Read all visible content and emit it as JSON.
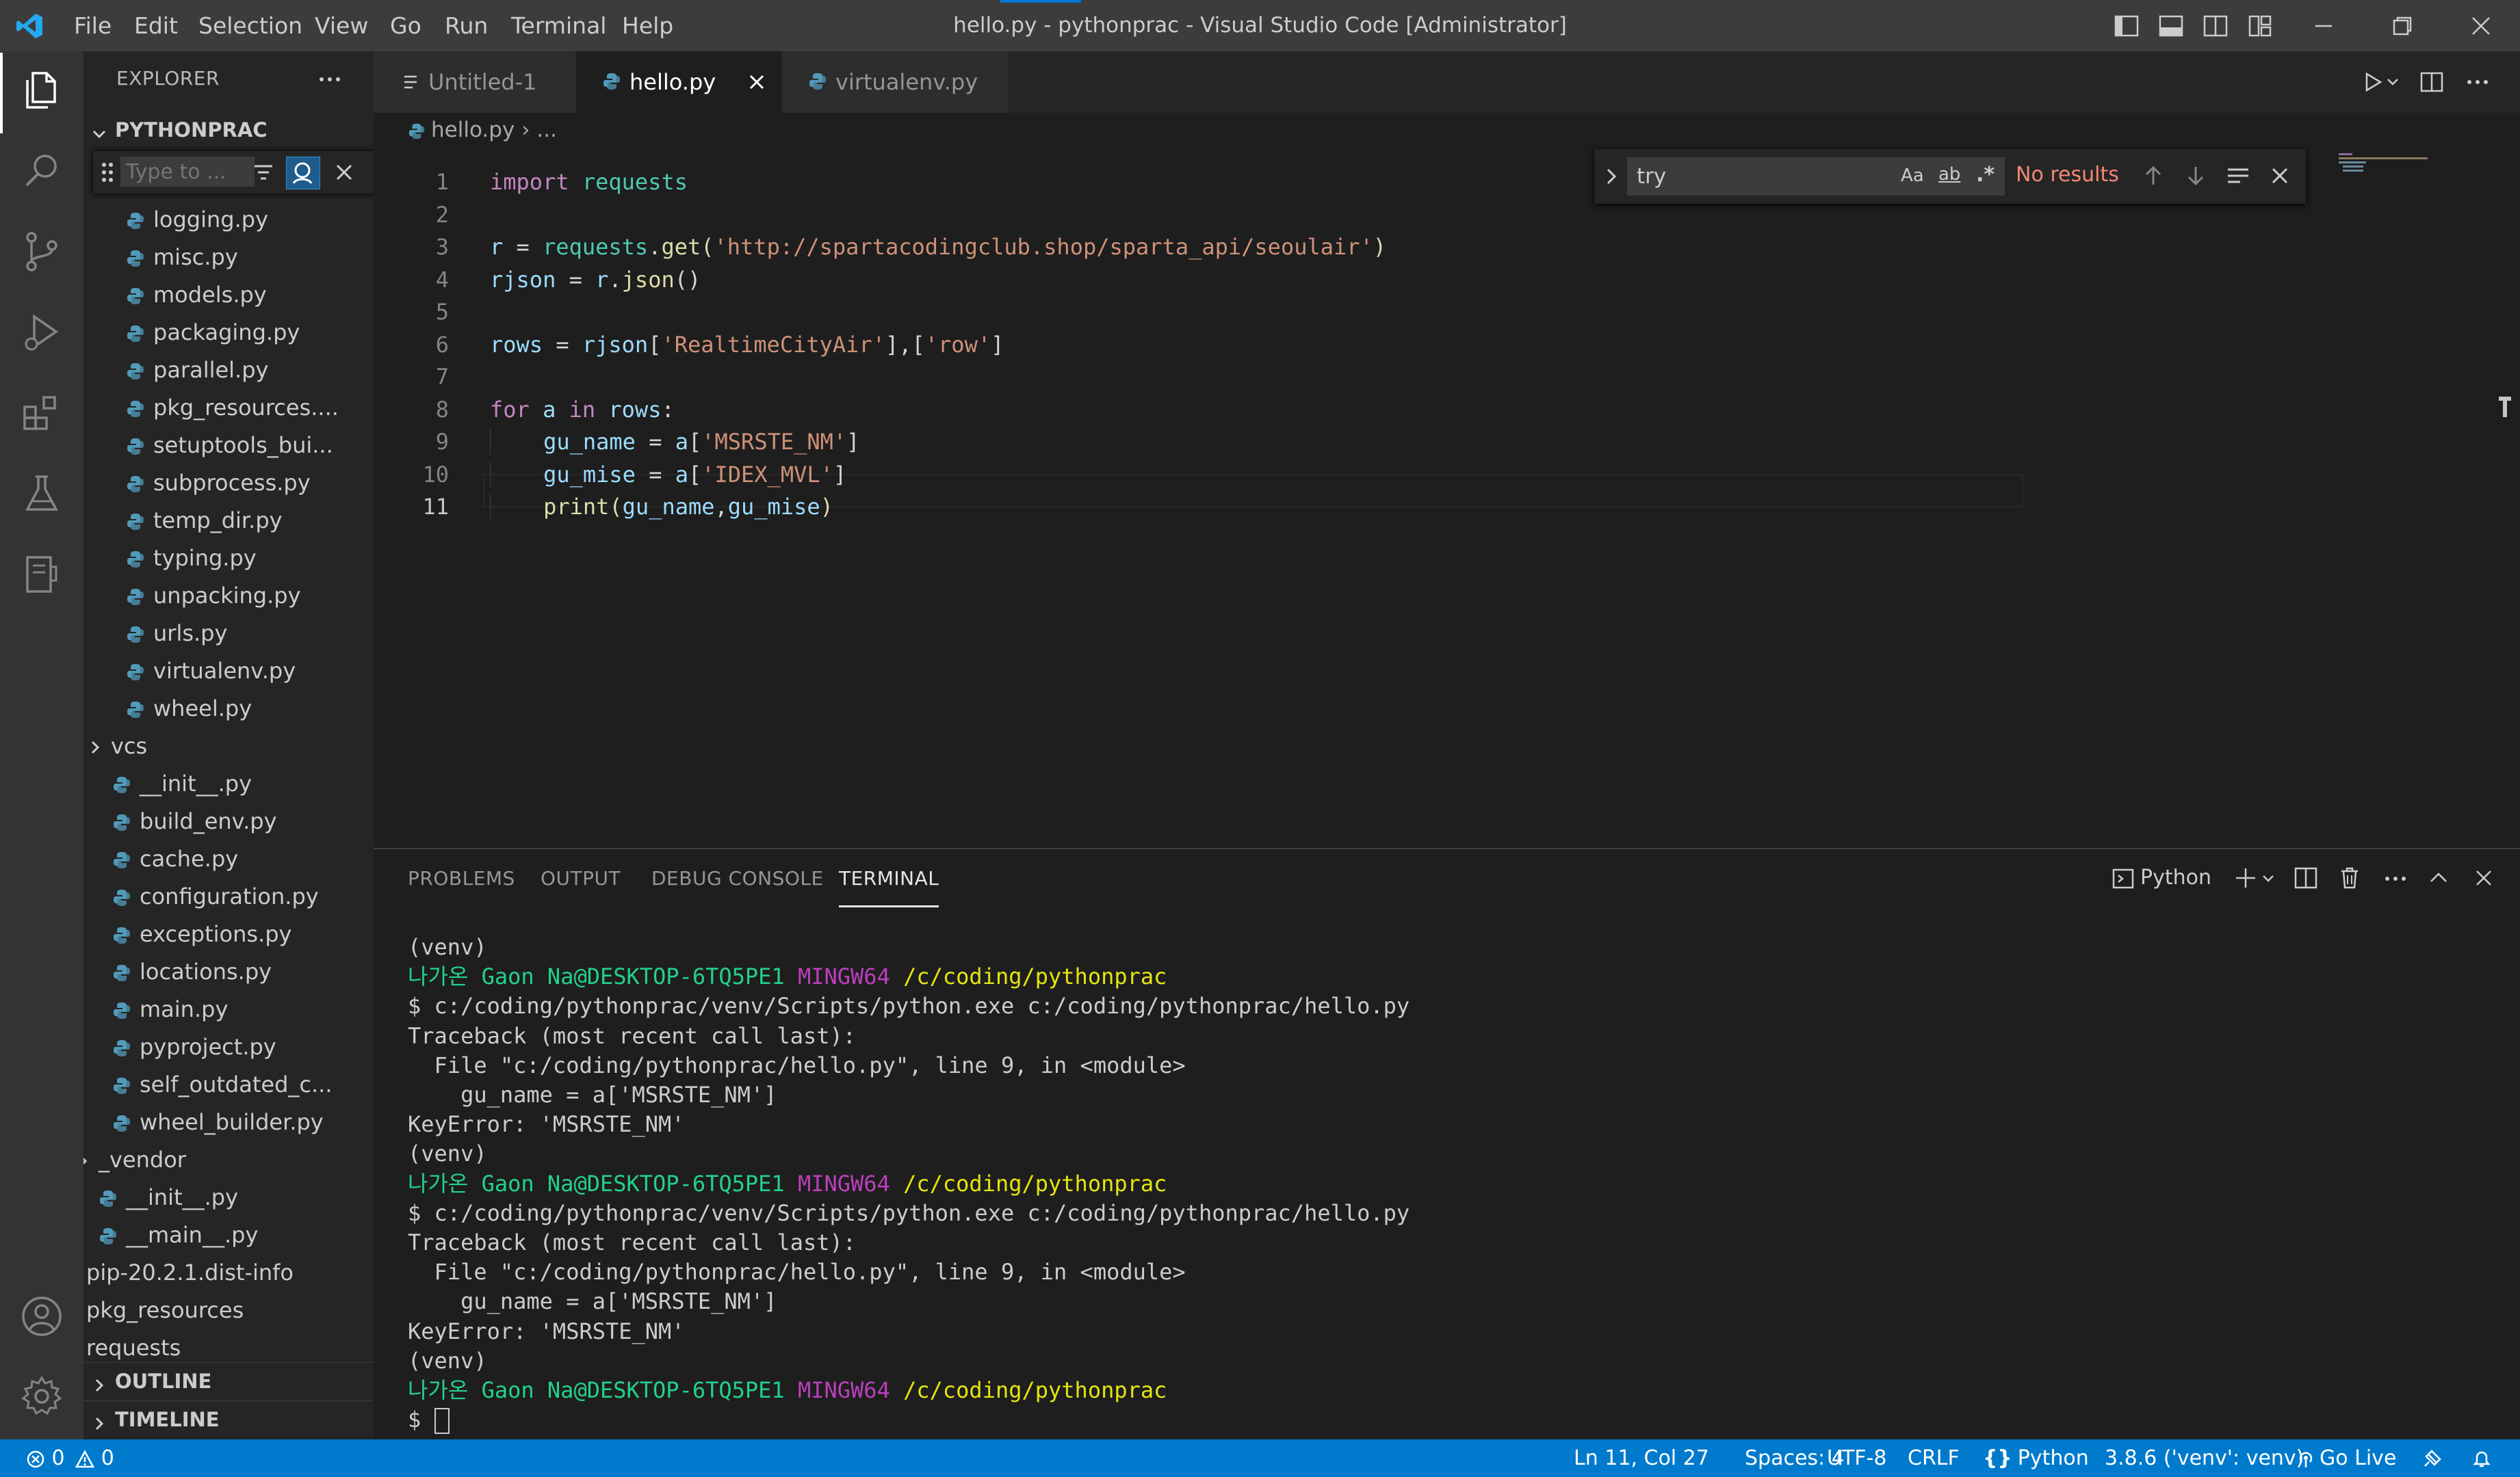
{
  "titlebar": {
    "menus": [
      "File",
      "Edit",
      "Selection",
      "View",
      "Go",
      "Run",
      "Terminal",
      "Help"
    ],
    "title": "hello.py - pythonprac - Visual Studio Code [Administrator]"
  },
  "sidebar": {
    "header": "EXPLORER",
    "folder": "PYTHONPRAC",
    "filter_placeholder": "Type to ...",
    "items": [
      {
        "label": "logging.py",
        "type": "file"
      },
      {
        "label": "misc.py",
        "type": "file"
      },
      {
        "label": "models.py",
        "type": "file"
      },
      {
        "label": "packaging.py",
        "type": "file"
      },
      {
        "label": "parallel.py",
        "type": "file"
      },
      {
        "label": "pkg_resources....",
        "type": "file"
      },
      {
        "label": "setuptools_bui...",
        "type": "file"
      },
      {
        "label": "subprocess.py",
        "type": "file"
      },
      {
        "label": "temp_dir.py",
        "type": "file"
      },
      {
        "label": "typing.py",
        "type": "file"
      },
      {
        "label": "unpacking.py",
        "type": "file"
      },
      {
        "label": "urls.py",
        "type": "file"
      },
      {
        "label": "virtualenv.py",
        "type": "file"
      },
      {
        "label": "wheel.py",
        "type": "file"
      },
      {
        "label": "vcs",
        "type": "folder"
      },
      {
        "label": "__init__.py",
        "type": "file"
      },
      {
        "label": "build_env.py",
        "type": "file"
      },
      {
        "label": "cache.py",
        "type": "file"
      },
      {
        "label": "configuration.py",
        "type": "file"
      },
      {
        "label": "exceptions.py",
        "type": "file"
      },
      {
        "label": "locations.py",
        "type": "file"
      },
      {
        "label": "main.py",
        "type": "file"
      },
      {
        "label": "pyproject.py",
        "type": "file"
      },
      {
        "label": "self_outdated_c...",
        "type": "file"
      },
      {
        "label": "wheel_builder.py",
        "type": "file"
      },
      {
        "label": "_vendor",
        "type": "folder"
      },
      {
        "label": "__init__.py",
        "type": "file"
      },
      {
        "label": "__main__.py",
        "type": "file"
      },
      {
        "label": "pip-20.2.1.dist-info",
        "type": "folder"
      },
      {
        "label": "pkg_resources",
        "type": "folder"
      },
      {
        "label": "requests",
        "type": "folder"
      }
    ],
    "outline": "OUTLINE",
    "timeline": "TIMELINE"
  },
  "tabs": [
    {
      "label": "Untitled-1"
    },
    {
      "label": "hello.py"
    },
    {
      "label": "virtualenv.py"
    }
  ],
  "breadcrumb": {
    "file": "hello.py",
    "rest": "..."
  },
  "find": {
    "query": "try",
    "results": "No results",
    "case": "Aa",
    "word": "ab",
    "regex": ".*"
  },
  "editor": {
    "line_numbers": [
      "1",
      "2",
      "3",
      "4",
      "5",
      "6",
      "7",
      "8",
      "9",
      "10",
      "11"
    ],
    "lines": {
      "l1": {
        "kw": "import",
        "mod": "requests"
      },
      "l3": {
        "var": "r",
        "eq": " = ",
        "mod": "requests",
        "dot": ".",
        "fn": "get",
        "open": "(",
        "str": "'http://spartacodingclub.shop/sparta_api/seoulair'",
        "close": ")"
      },
      "l4": {
        "var": "rjson",
        "eq": " = ",
        "obj": "r",
        "dot": ".",
        "fn": "json",
        "paren": "()"
      },
      "l6": {
        "var": "rows",
        "eq": " = ",
        "obj": "rjson",
        "b1": "[",
        "s1": "'RealtimeCityAir'",
        "b2": "],[",
        "s2": "'row'",
        "b3": "]"
      },
      "l8": {
        "kw": "for",
        "v1": "a",
        "in": "in",
        "v2": "rows",
        "colon": ":"
      },
      "l9": {
        "var": "gu_name",
        "eq": " = ",
        "obj": "a",
        "b1": "[",
        "str": "'MSRSTE_NM'",
        "b2": "]"
      },
      "l10": {
        "var": "gu_mise",
        "eq": " = ",
        "obj": "a",
        "b1": "[",
        "str": "'IDEX_MVL'",
        "b2": "]"
      },
      "l11": {
        "fn": "print",
        "open": "(",
        "a1": "gu_name",
        "comma": ",",
        "a2": "gu_mise",
        "close": ")"
      }
    }
  },
  "panel": {
    "tabs": [
      "PROBLEMS",
      "OUTPUT",
      "DEBUG CONSOLE",
      "TERMINAL"
    ],
    "terminal_name": "Python",
    "terminal": {
      "venv": "(venv)",
      "user": "나가온 Gaon Na@DESKTOP-6TQ5PE1",
      "shell": "MINGW64",
      "path": "/c/coding/pythonprac",
      "cmd": "$ c:/coding/pythonprac/venv/Scripts/python.exe c:/coding/pythonprac/hello.py",
      "tb": "Traceback (most recent call last):",
      "file": "  File \"c:/coding/pythonprac/hello.py\", line 9, in <module>",
      "code": "    gu_name = a['MSRSTE_NM']",
      "err": "KeyError: 'MSRSTE_NM'",
      "prompt": "$ "
    }
  },
  "statusbar": {
    "errors": "0",
    "warnings": "0",
    "position": "Ln 11, Col 27",
    "spaces": "Spaces: 4",
    "encoding": "UTF-8",
    "eol": "CRLF",
    "language": "Python",
    "interpreter": "3.8.6 ('venv': venv)",
    "golive": "Go Live"
  },
  "colors": {
    "statusbar": "#007acc",
    "accent": "#0078d4"
  }
}
